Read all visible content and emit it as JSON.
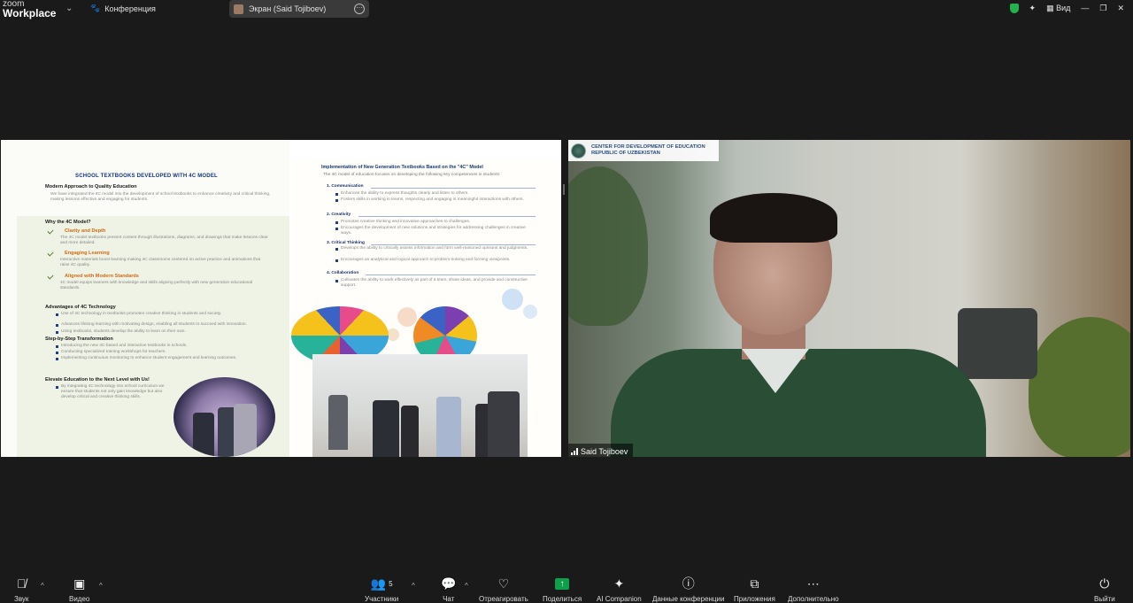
{
  "app": {
    "brand_line1": "zoom",
    "brand_line2": "Workplace"
  },
  "topbar": {
    "meeting_label": "Конференция",
    "share_label": "Экран (Said Tojiboev)",
    "view_label": "Вид"
  },
  "slide": {
    "title": "SCHOOL TEXTBOOKS DEVELOPED WITH 4C MODEL",
    "left": {
      "intro_heading": "Modern Approach to Quality Education",
      "intro_text": "We have integrated the 4C model into the development of school textbooks to enhance creativity and critical thinking, making lessons effective and engaging for students.",
      "why_heading": "Why the 4C Model?",
      "items": [
        {
          "title": "Clarity and Depth",
          "text": "The 4C model textbooks present content through illustrations, diagrams, and drawings that make lessons clear and more detailed."
        },
        {
          "title": "Engaging Learning",
          "text": "Interactive materials boost learning making 4C classrooms centered on active practice and animations that raise 4C quality."
        },
        {
          "title": "Aligned with Modern Standards",
          "text": "4C model equips learners with knowledge and skills aligning perfectly with new generation educational standards."
        }
      ],
      "advantages_heading": "Advantages of 4C Technology",
      "advantages": [
        "Use of 4C technology in textbooks promotes creative thinking in students and society.",
        "Advances lifelong learning with motivating design, enabling all students to succeed with innovation.",
        "Using textbooks, students develop the ability to learn on their own."
      ],
      "steps_heading": "Step-by-Step Transformation",
      "steps": [
        "Introducing the new 4C-based and interactive textbooks in schools.",
        "Conducting specialized training workshops for teachers.",
        "Implementing continuous monitoring to enhance student engagement and learning outcomes."
      ],
      "elevate_heading": "Elevate Education to the Next Level with Us!",
      "elevate_text": "By integrating 4C technology into school curriculum we ensure that students not only gain knowledge but also develop critical and creative thinking skills."
    },
    "right": {
      "title": "Implementation of New Generation Textbooks Based on the \"4C\" Model",
      "intro": "The 4C model of education focuses on developing the following key competencies in students:",
      "sections": [
        {
          "heading": "1. Communication",
          "bullets": [
            "Enhances the ability to express thoughts clearly and listen to others.",
            "Fosters skills in working in teams, respecting and engaging in meaningful interactions with others."
          ]
        },
        {
          "heading": "2. Creativity",
          "bullets": [
            "Promotes creative thinking and innovative approaches to challenges.",
            "Encourages the development of new solutions and strategies for addressing challenges in creative ways."
          ]
        },
        {
          "heading": "3. Critical Thinking",
          "bullets": [
            "Develops the ability to critically assess information and form well-reasoned opinions and judgments.",
            "Encourages an analytical and logical approach to problem-solving and forming viewpoints."
          ]
        },
        {
          "heading": "4. Collaboration",
          "bullets": [
            "Cultivates the ability to work effectively as part of a team, share ideas, and provide and constructive support."
          ]
        }
      ]
    }
  },
  "video": {
    "org_line1": "CENTER FOR DEVELOPMENT OF EDUCATION",
    "org_line2": "REPUBLIC OF UZBEKISTAN",
    "participant_name": "Said Tojiboev"
  },
  "toolbar": {
    "audio": "Звук",
    "video": "Видео",
    "participants": "Участники",
    "participants_count": "5",
    "chat": "Чат",
    "react": "Отреагировать",
    "share": "Поделиться",
    "ai": "AI Companion",
    "info": "Данные конференции",
    "apps": "Приложения",
    "more": "Дополнительно",
    "leave": "Выйти"
  },
  "colors": {
    "zoom_green": "#0e9f4b",
    "mute_red": "#e02f2f",
    "slide_heading_blue": "#15377a",
    "accent_orange": "#d26a12"
  }
}
